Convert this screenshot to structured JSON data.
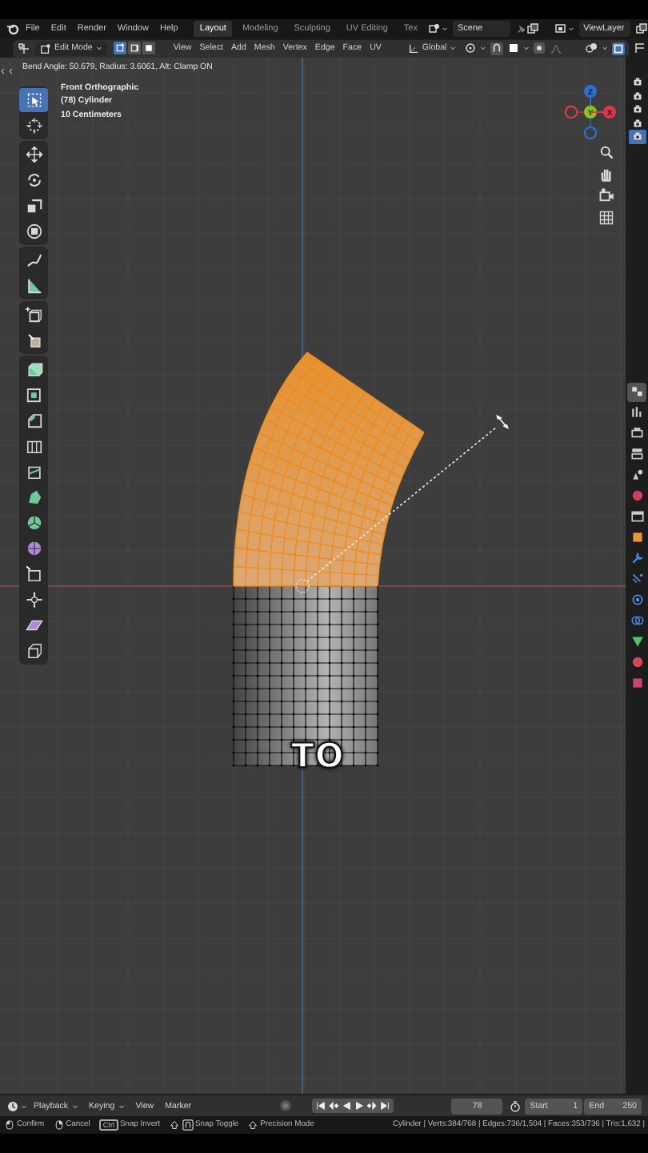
{
  "top_menu": [
    "File",
    "Edit",
    "Render",
    "Window",
    "Help"
  ],
  "workspaces": [
    {
      "label": "Layout",
      "selected": true
    },
    {
      "label": "Modeling",
      "selected": false
    },
    {
      "label": "Sculpting",
      "selected": false
    },
    {
      "label": "UV Editing",
      "selected": false
    },
    {
      "label": "Tex",
      "selected": false
    }
  ],
  "scene": "Scene",
  "view_layer": "ViewLayer",
  "header": {
    "mode": "Edit Mode",
    "select_modes": [
      {
        "kind": "vertex",
        "selected": true
      },
      {
        "kind": "edge",
        "selected": false
      },
      {
        "kind": "face",
        "selected": false
      }
    ],
    "menus": [
      "View",
      "Select",
      "Add",
      "Mesh",
      "Vertex",
      "Edge",
      "Face",
      "UV"
    ],
    "orientation": "Global"
  },
  "operator_status": "Bend Angle: 50.679, Radius: 3.6061, Alt: Clamp ON",
  "viewport": {
    "view_name": "Front Orthographic",
    "object_label": "(78) Cylinder",
    "grid_scale": "10 Centimeters",
    "caption": "TO"
  },
  "gizmo_axes": [
    {
      "kind": "z",
      "label": "Z",
      "color": "#2f6fd0"
    },
    {
      "kind": "y",
      "label": "Y",
      "color": "#8cc21a"
    },
    {
      "kind": "x",
      "label": "X",
      "color": "#e0364c"
    }
  ],
  "tool_groups": [
    [
      {
        "kind": "select",
        "selected": true
      },
      {
        "kind": "cursor",
        "selected": false
      }
    ],
    [
      {
        "kind": "move",
        "selected": false
      },
      {
        "kind": "rotate",
        "selected": false
      },
      {
        "kind": "scale",
        "selected": false
      },
      {
        "kind": "transform",
        "selected": false
      }
    ],
    [
      {
        "kind": "annotate",
        "selected": false
      },
      {
        "kind": "measure",
        "selected": false
      }
    ],
    [
      {
        "kind": "add-cube",
        "selected": false
      },
      {
        "kind": "extrude",
        "selected": false
      }
    ],
    [
      {
        "kind": "extrude-region",
        "selected": false
      },
      {
        "kind": "inset",
        "selected": false
      },
      {
        "kind": "bevel",
        "selected": false
      },
      {
        "kind": "loop-cut",
        "selected": false
      },
      {
        "kind": "knife",
        "selected": false
      },
      {
        "kind": "poly-build",
        "selected": false
      },
      {
        "kind": "spin",
        "selected": false
      },
      {
        "kind": "smooth",
        "selected": false
      },
      {
        "kind": "slide",
        "selected": false
      },
      {
        "kind": "shrink",
        "selected": false
      },
      {
        "kind": "shear",
        "selected": false
      },
      {
        "kind": "rip",
        "selected": false
      }
    ]
  ],
  "restrict_toggles": [
    {
      "selected": false
    },
    {
      "selected": false
    },
    {
      "selected": false
    },
    {
      "selected": false
    },
    {
      "selected": true
    }
  ],
  "property_tabs": [
    {
      "kind": "tool",
      "selected": true
    },
    {
      "kind": "render",
      "selected": false
    },
    {
      "kind": "output",
      "selected": false
    },
    {
      "kind": "view-layer",
      "selected": false
    },
    {
      "kind": "scene",
      "selected": false
    },
    {
      "kind": "world",
      "selected": false
    },
    {
      "kind": "collection",
      "selected": false
    },
    {
      "kind": "object",
      "selected": false
    },
    {
      "kind": "modifier",
      "selected": false
    },
    {
      "kind": "particles",
      "selected": false
    },
    {
      "kind": "physics",
      "selected": false
    },
    {
      "kind": "constraints",
      "selected": false
    },
    {
      "kind": "data",
      "selected": false
    },
    {
      "kind": "material",
      "selected": false
    },
    {
      "kind": "texture",
      "selected": false
    }
  ],
  "timeline": {
    "menus": [
      {
        "label": "Playback",
        "dropdown": true
      },
      {
        "label": "Keying",
        "dropdown": true
      },
      {
        "label": "View",
        "dropdown": false
      },
      {
        "label": "Marker",
        "dropdown": false
      }
    ],
    "current_frame": "78",
    "start_label": "Start",
    "start": "1",
    "end_label": "End",
    "end": "250"
  },
  "status_bar": {
    "hints": [
      {
        "kind": "mouse-left",
        "label": "Confirm"
      },
      {
        "kind": "mouse-right",
        "label": "Cancel"
      },
      {
        "kind": "ctrl",
        "key": "Ctrl",
        "label": "Snap Invert"
      },
      {
        "kind": "shift-snap",
        "label": "Snap Toggle"
      },
      {
        "kind": "shift",
        "label": "Precision Mode"
      }
    ],
    "stats": "Cylinder | Verts:384/768 | Edges:736/1,504 | Faces:353/736 | Tris:1,632 |"
  }
}
